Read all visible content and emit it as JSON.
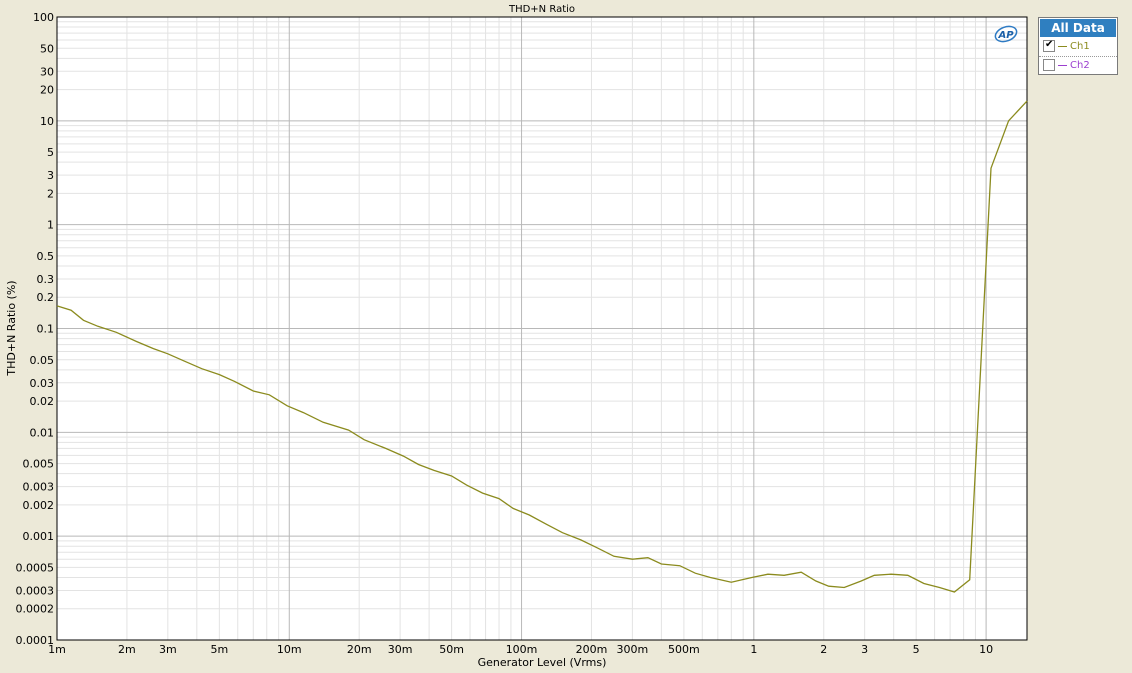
{
  "chart_data": {
    "type": "line",
    "title": "THD+N Ratio",
    "xlabel": "Generator Level (Vrms)",
    "ylabel": "THD+N Ratio (%)",
    "xscale": "log",
    "yscale": "log",
    "xlim": [
      0.001,
      15
    ],
    "ylim": [
      0.0001,
      100
    ],
    "grid": true,
    "legend_placement": "top-right outside",
    "x_ticks": [
      {
        "v": 0.001,
        "label": "1m"
      },
      {
        "v": 0.002,
        "label": "2m"
      },
      {
        "v": 0.003,
        "label": "3m"
      },
      {
        "v": 0.005,
        "label": "5m"
      },
      {
        "v": 0.01,
        "label": "10m"
      },
      {
        "v": 0.02,
        "label": "20m"
      },
      {
        "v": 0.03,
        "label": "30m"
      },
      {
        "v": 0.05,
        "label": "50m"
      },
      {
        "v": 0.1,
        "label": "100m"
      },
      {
        "v": 0.2,
        "label": "200m"
      },
      {
        "v": 0.3,
        "label": "300m"
      },
      {
        "v": 0.5,
        "label": "500m"
      },
      {
        "v": 1,
        "label": "1"
      },
      {
        "v": 2,
        "label": "2"
      },
      {
        "v": 3,
        "label": "3"
      },
      {
        "v": 5,
        "label": "5"
      },
      {
        "v": 10,
        "label": "10"
      }
    ],
    "y_ticks": [
      {
        "v": 100,
        "label": "100"
      },
      {
        "v": 50,
        "label": "50"
      },
      {
        "v": 30,
        "label": "30"
      },
      {
        "v": 20,
        "label": "20"
      },
      {
        "v": 10,
        "label": "10"
      },
      {
        "v": 5,
        "label": "5"
      },
      {
        "v": 3,
        "label": "3"
      },
      {
        "v": 2,
        "label": "2"
      },
      {
        "v": 1,
        "label": "1"
      },
      {
        "v": 0.5,
        "label": "0.5"
      },
      {
        "v": 0.3,
        "label": "0.3"
      },
      {
        "v": 0.2,
        "label": "0.2"
      },
      {
        "v": 0.1,
        "label": "0.1"
      },
      {
        "v": 0.05,
        "label": "0.05"
      },
      {
        "v": 0.03,
        "label": "0.03"
      },
      {
        "v": 0.02,
        "label": "0.02"
      },
      {
        "v": 0.01,
        "label": "0.01"
      },
      {
        "v": 0.005,
        "label": "0.005"
      },
      {
        "v": 0.003,
        "label": "0.003"
      },
      {
        "v": 0.002,
        "label": "0.002"
      },
      {
        "v": 0.001,
        "label": "0.001"
      },
      {
        "v": 0.0005,
        "label": "0.0005"
      },
      {
        "v": 0.0003,
        "label": "0.0003"
      },
      {
        "v": 0.0002,
        "label": "0.0002"
      },
      {
        "v": 0.0001,
        "label": "0.0001"
      }
    ],
    "series": [
      {
        "name": "Ch1",
        "color": "#8b8b1e",
        "visible": true,
        "points": [
          [
            0.001,
            0.165
          ],
          [
            0.00115,
            0.15
          ],
          [
            0.0013,
            0.12
          ],
          [
            0.0015,
            0.105
          ],
          [
            0.0018,
            0.092
          ],
          [
            0.0022,
            0.075
          ],
          [
            0.0026,
            0.064
          ],
          [
            0.003,
            0.057
          ],
          [
            0.0035,
            0.049
          ],
          [
            0.0042,
            0.041
          ],
          [
            0.005,
            0.036
          ],
          [
            0.0058,
            0.031
          ],
          [
            0.007,
            0.025
          ],
          [
            0.0082,
            0.023
          ],
          [
            0.0098,
            0.018
          ],
          [
            0.0115,
            0.0155
          ],
          [
            0.014,
            0.0125
          ],
          [
            0.018,
            0.0105
          ],
          [
            0.021,
            0.0085
          ],
          [
            0.026,
            0.007
          ],
          [
            0.031,
            0.0059
          ],
          [
            0.036,
            0.0049
          ],
          [
            0.042,
            0.0043
          ],
          [
            0.05,
            0.0038
          ],
          [
            0.058,
            0.0031
          ],
          [
            0.068,
            0.0026
          ],
          [
            0.08,
            0.0023
          ],
          [
            0.092,
            0.00185
          ],
          [
            0.108,
            0.0016
          ],
          [
            0.128,
            0.0013
          ],
          [
            0.15,
            0.00108
          ],
          [
            0.18,
            0.00092
          ],
          [
            0.21,
            0.00078
          ],
          [
            0.25,
            0.00064
          ],
          [
            0.3,
            0.0006
          ],
          [
            0.35,
            0.00062
          ],
          [
            0.4,
            0.00054
          ],
          [
            0.48,
            0.00052
          ],
          [
            0.56,
            0.00044
          ],
          [
            0.65,
            0.0004
          ],
          [
            0.8,
            0.00036
          ],
          [
            0.98,
            0.0004
          ],
          [
            1.15,
            0.00043
          ],
          [
            1.35,
            0.00042
          ],
          [
            1.6,
            0.00045
          ],
          [
            1.85,
            0.00037
          ],
          [
            2.1,
            0.00033
          ],
          [
            2.45,
            0.00032
          ],
          [
            2.9,
            0.00037
          ],
          [
            3.3,
            0.00042
          ],
          [
            3.9,
            0.00043
          ],
          [
            4.6,
            0.00042
          ],
          [
            5.4,
            0.00035
          ],
          [
            6.3,
            0.00032
          ],
          [
            7.3,
            0.00029
          ],
          [
            8.5,
            0.00038
          ],
          [
            10.5,
            3.5
          ],
          [
            12.5,
            10
          ],
          [
            15,
            15.5
          ]
        ]
      },
      {
        "name": "Ch2",
        "color": "#9b3fcf",
        "visible": false,
        "points": []
      }
    ]
  },
  "legend": {
    "header": "All Data",
    "items": [
      {
        "label": "Ch1",
        "checked": true,
        "color": "#8b8b1e"
      },
      {
        "label": "Ch2",
        "checked": false,
        "color": "#9b3fcf"
      }
    ]
  },
  "logo": {
    "text": "AP"
  }
}
